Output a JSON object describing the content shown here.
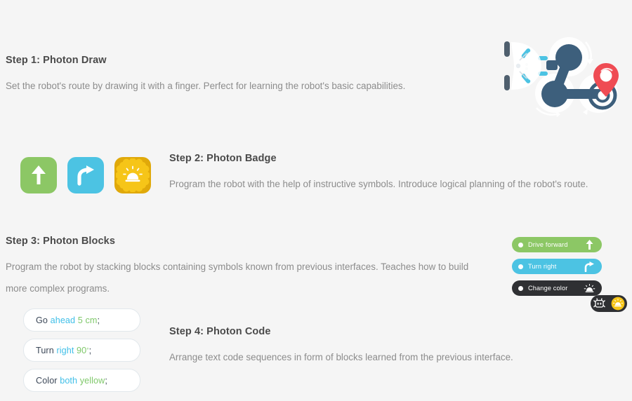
{
  "page": {
    "background_color": "#f5f5f5"
  },
  "steps": [
    {
      "title": "Step 1: Photon Draw",
      "description": "Set the robot's route by drawing it with a finger. Perfect for learning the robot's basic capabilities."
    },
    {
      "title": "Step 2: Photon Badge",
      "description": "Program the robot with the help of instructive symbols. Introduce logical planning of the robot's route."
    },
    {
      "title": "Step 3: Photon Blocks",
      "description": "Program the robot by stacking blocks containing symbols known from previous interfaces. Teaches how to build more complex programs."
    },
    {
      "title": "Step 4: Photon Code",
      "description": "Arrange text code sequences in form of blocks learned from the previous interface."
    }
  ],
  "badges": [
    {
      "icon": "arrow-up-icon",
      "color": "#8cc765"
    },
    {
      "icon": "turn-right-arrow-icon",
      "color": "#4cc3e3"
    },
    {
      "icon": "sun-lamp-icon",
      "color": "#e0a90a"
    }
  ],
  "blocks": [
    {
      "label": "Drive forward",
      "icon": "arrow-up-icon",
      "color": "#8cc765"
    },
    {
      "label": "Turn right",
      "icon": "turn-right-arrow-icon",
      "color": "#4cc3e3"
    },
    {
      "label": "Change color",
      "icon": "sun-lamp-icon",
      "color": "#2f3033"
    }
  ],
  "color_pill": {
    "robot_icon": "robot-face-icon",
    "swatch_icon": "sun-lamp-icon",
    "swatch_color": "#f6c518"
  },
  "code_lines": [
    {
      "keyword": "Go",
      "arg1": "ahead",
      "arg2": "5 cm",
      "terminator": ";"
    },
    {
      "keyword": "Turn",
      "arg1": "right",
      "arg2": "90",
      "degree": "°",
      "terminator": ";"
    },
    {
      "keyword": "Color",
      "arg1": "both",
      "arg2": "yellow",
      "terminator": ";"
    }
  ],
  "robot_art": {
    "name": "photon-robot-route-illustration",
    "robot_body_color": "#ffffff",
    "route_color": "#3d5f7c",
    "marker_color": "#ef4b53",
    "accent_color": "#4cc3e3"
  }
}
